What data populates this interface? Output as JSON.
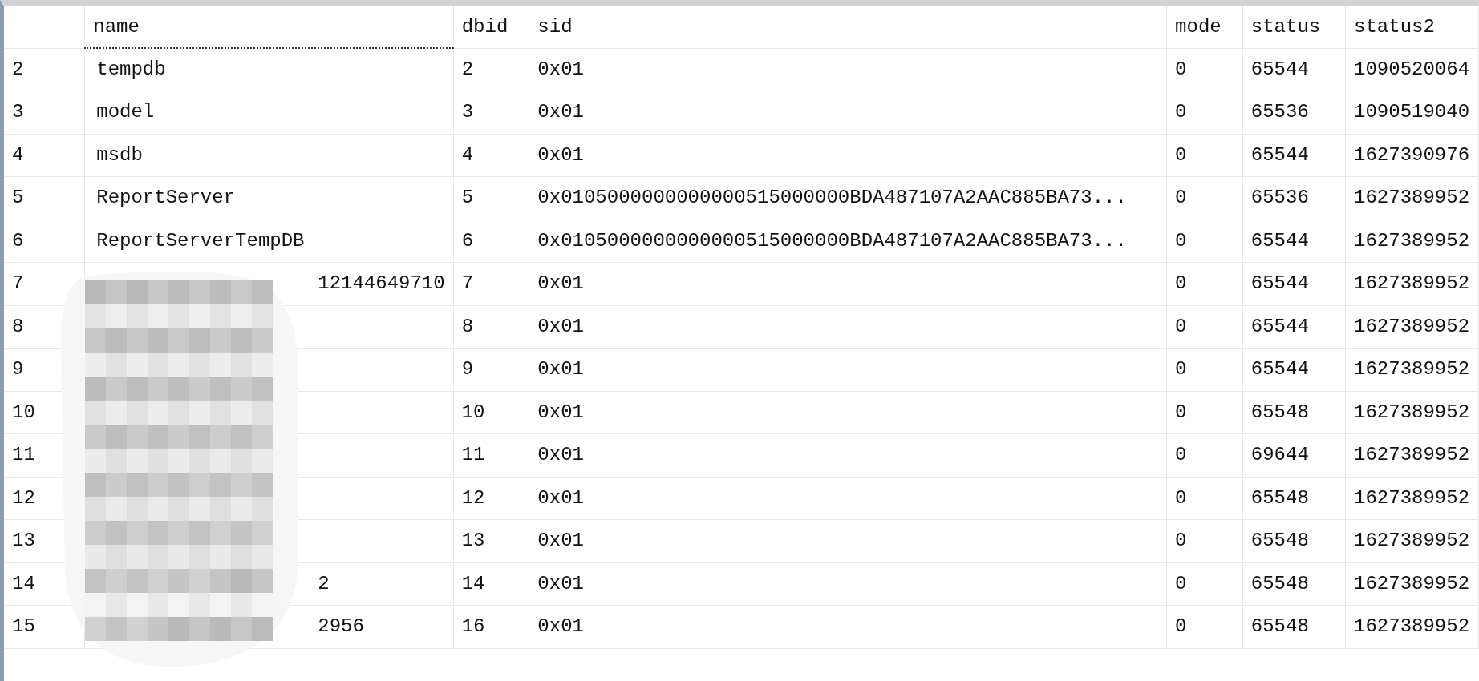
{
  "grid": {
    "columns": [
      {
        "label": "name",
        "selected": true
      },
      {
        "label": "dbid",
        "selected": false
      },
      {
        "label": "sid",
        "selected": false
      },
      {
        "label": "mode",
        "selected": false
      },
      {
        "label": "status",
        "selected": false
      },
      {
        "label": "status2",
        "selected": false
      }
    ],
    "rows": [
      {
        "number": "2",
        "redacted": false,
        "cells": [
          "tempdb",
          "2",
          "0x01",
          "0",
          "65544",
          "1090520064"
        ]
      },
      {
        "number": "3",
        "redacted": false,
        "cells": [
          "model",
          "3",
          "0x01",
          "0",
          "65536",
          "1090519040"
        ]
      },
      {
        "number": "4",
        "redacted": false,
        "cells": [
          "msdb",
          "4",
          "0x01",
          "0",
          "65544",
          "1627390976"
        ]
      },
      {
        "number": "5",
        "redacted": false,
        "cells": [
          "ReportServer",
          "5",
          "0x0105000000000000515000000BDA487107A2AAC885BA73...",
          "0",
          "65536",
          "1627389952"
        ]
      },
      {
        "number": "6",
        "redacted": false,
        "cells": [
          "ReportServerTempDB",
          "6",
          "0x0105000000000000515000000BDA487107A2AAC885BA73...",
          "0",
          "65544",
          "1627389952"
        ]
      },
      {
        "number": "7",
        "redacted": true,
        "cells": [
          "12144649710",
          "7",
          "0x01",
          "0",
          "65544",
          "1627389952"
        ]
      },
      {
        "number": "8",
        "redacted": true,
        "cells": [
          "",
          "8",
          "0x01",
          "0",
          "65544",
          "1627389952"
        ]
      },
      {
        "number": "9",
        "redacted": true,
        "cells": [
          "",
          "9",
          "0x01",
          "0",
          "65544",
          "1627389952"
        ]
      },
      {
        "number": "10",
        "redacted": true,
        "cells": [
          "",
          "10",
          "0x01",
          "0",
          "65548",
          "1627389952"
        ]
      },
      {
        "number": "11",
        "redacted": true,
        "cells": [
          "",
          "11",
          "0x01",
          "0",
          "69644",
          "1627389952"
        ]
      },
      {
        "number": "12",
        "redacted": true,
        "cells": [
          "",
          "12",
          "0x01",
          "0",
          "65548",
          "1627389952"
        ]
      },
      {
        "number": "13",
        "redacted": true,
        "cells": [
          "",
          "13",
          "0x01",
          "0",
          "65548",
          "1627389952"
        ]
      },
      {
        "number": "14",
        "redacted": true,
        "cells": [
          "2",
          "14",
          "0x01",
          "0",
          "65548",
          "1627389952"
        ]
      },
      {
        "number": "15",
        "redacted": true,
        "cells": [
          "2956",
          "16",
          "0x01",
          "0",
          "65548",
          "1627389952"
        ]
      }
    ]
  }
}
